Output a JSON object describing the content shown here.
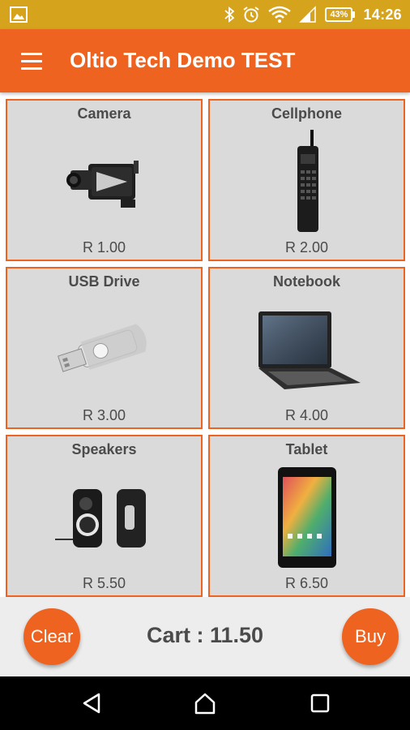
{
  "status_bar": {
    "time": "14:26",
    "battery": "43%",
    "icons": [
      "image-icon",
      "bluetooth-icon",
      "alarm-icon",
      "wifi-icon",
      "signal-icon",
      "battery-icon"
    ]
  },
  "app_bar": {
    "title": "Oltio Tech Demo TEST",
    "menu_icon": "menu-icon"
  },
  "products": [
    {
      "name": "Camera",
      "price": "R 1.00",
      "icon": "camera-icon"
    },
    {
      "name": "Cellphone",
      "price": "R 2.00",
      "icon": "cellphone-icon"
    },
    {
      "name": "USB Drive",
      "price": "R 3.00",
      "icon": "usb-drive-icon"
    },
    {
      "name": "Notebook",
      "price": "R 4.00",
      "icon": "notebook-icon"
    },
    {
      "name": "Speakers",
      "price": "R 5.50",
      "icon": "speakers-icon"
    },
    {
      "name": "Tablet",
      "price": "R 6.50",
      "icon": "tablet-icon"
    }
  ],
  "cart": {
    "clear_label": "Clear",
    "total_label": "Cart : 11.50",
    "buy_label": "Buy"
  },
  "nav_bar": {
    "icons": [
      "back-icon",
      "home-icon",
      "recents-icon"
    ]
  },
  "colors": {
    "accent": "#ef6321",
    "status_bar": "#d6a31d",
    "tile_background": "#dadada",
    "text": "#4b4b4b"
  }
}
